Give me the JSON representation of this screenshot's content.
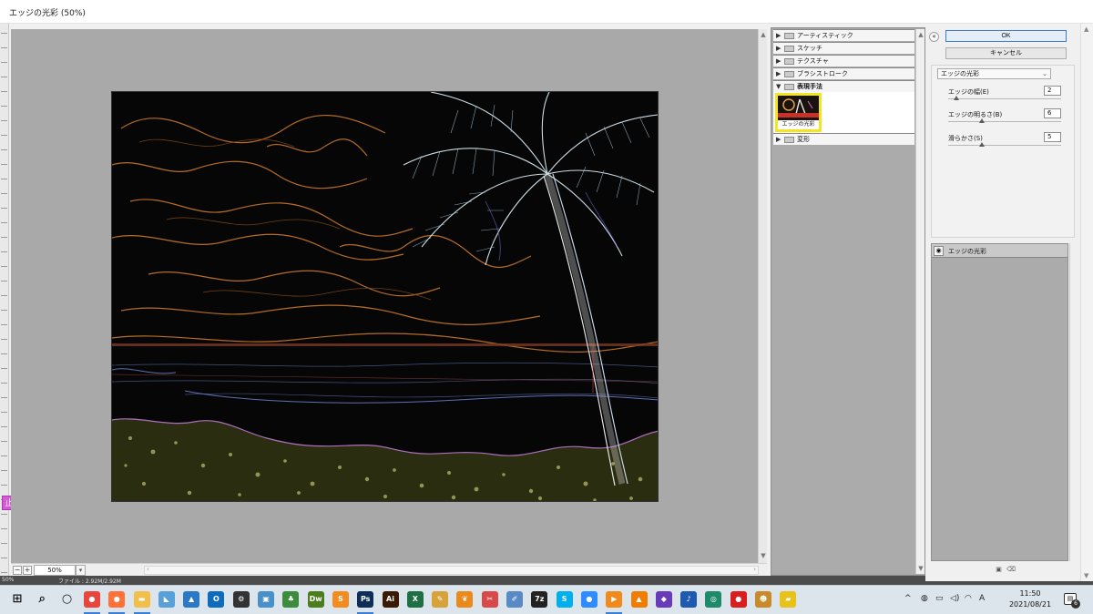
{
  "window": {
    "title": "エッジの光彩 (50%)"
  },
  "ruler": {
    "marker": "止"
  },
  "bottom_bar": {
    "zoom_value": "50%",
    "minus_label": "−",
    "plus_label": "+",
    "dropdown_arrow": "▾",
    "scroll_left": "‹",
    "scroll_right": "›"
  },
  "status_strip": {
    "zoom": "50%",
    "doc_info": "ファイル : 2.92M/2.92M"
  },
  "filter_gallery": {
    "categories": [
      {
        "label": "アーティスティック",
        "expanded": false
      },
      {
        "label": "スケッチ",
        "expanded": false
      },
      {
        "label": "テクスチャ",
        "expanded": false
      },
      {
        "label": "ブラシストローク",
        "expanded": false
      },
      {
        "label": "表現手法",
        "expanded": true
      },
      {
        "label": "変形",
        "expanded": false
      }
    ],
    "selected_thumbnail_label": "エッジの光彩",
    "arrow_collapsed": "▶",
    "arrow_expanded": "▼"
  },
  "dialog": {
    "collapse_icon": "«",
    "ok_label": "OK",
    "cancel_label": "キャンセル",
    "filter_select_value": "エッジの光彩",
    "params": [
      {
        "label": "エッジの幅(E)",
        "value": "2",
        "slider_fraction": 0.07
      },
      {
        "label": "エッジの明るさ(B)",
        "value": "6",
        "slider_fraction": 0.3
      },
      {
        "label": "滑らかさ(S)",
        "value": "5",
        "slider_fraction": 0.3
      }
    ],
    "layer_name": "エッジの光彩",
    "new_layer_icon": "new-layer-icon",
    "delete_layer_icon": "trash-icon"
  },
  "taskbar": {
    "icons": [
      {
        "name": "start-icon",
        "glyph": "⊞",
        "color": "#1a1a1a"
      },
      {
        "name": "search-icon",
        "glyph": "⌕",
        "color": "#1a1a1a"
      },
      {
        "name": "cortana-icon",
        "glyph": "○",
        "color": "#1a1a1a"
      },
      {
        "name": "chrome-icon",
        "glyph": "●",
        "color": "#e8453c"
      },
      {
        "name": "firefox-icon",
        "glyph": "●",
        "color": "#ff7139"
      },
      {
        "name": "file-explorer-icon",
        "glyph": "▬",
        "color": "#f2c04a"
      },
      {
        "name": "app-icon",
        "glyph": "◣",
        "color": "#5aa0d8"
      },
      {
        "name": "photos-icon",
        "glyph": "▲",
        "color": "#2b78c6"
      },
      {
        "name": "outlook-icon",
        "glyph": "O",
        "color": "#0f6cbd"
      },
      {
        "name": "settings-gear-icon",
        "glyph": "⚙",
        "color": "#333333"
      },
      {
        "name": "remote-desktop-icon",
        "glyph": "▣",
        "color": "#4a90c8"
      },
      {
        "name": "green-app-icon",
        "glyph": "♣",
        "color": "#3d8c3d"
      },
      {
        "name": "dreamweaver-icon",
        "glyph": "Dw",
        "color": "#4b7c1d"
      },
      {
        "name": "sublime-text-icon",
        "glyph": "S",
        "color": "#f28c21"
      },
      {
        "name": "photoshop-icon",
        "glyph": "Ps",
        "color": "#0d2e57"
      },
      {
        "name": "illustrator-icon",
        "glyph": "Ai",
        "color": "#3a1a04"
      },
      {
        "name": "excel-icon",
        "glyph": "X",
        "color": "#1d7044"
      },
      {
        "name": "feather-app-icon",
        "glyph": "✎",
        "color": "#d8a23a"
      },
      {
        "name": "butterfly-app-icon",
        "glyph": "❦",
        "color": "#e88a1c"
      },
      {
        "name": "snipping-tool-icon",
        "glyph": "✂",
        "color": "#d84a4a"
      },
      {
        "name": "paint-icon",
        "glyph": "✐",
        "color": "#5a8ac6"
      },
      {
        "name": "7zip-icon",
        "glyph": "7z",
        "color": "#222222"
      },
      {
        "name": "skype-icon",
        "glyph": "S",
        "color": "#00aff0"
      },
      {
        "name": "zoom-icon",
        "glyph": "●",
        "color": "#2d8cff"
      },
      {
        "name": "media-player-icon",
        "glyph": "▶",
        "color": "#f08a1c"
      },
      {
        "name": "vlc-icon",
        "glyph": "▲",
        "color": "#f07c00"
      },
      {
        "name": "purple-app-icon",
        "glyph": "◆",
        "color": "#6a3bb8"
      },
      {
        "name": "music-app-icon",
        "glyph": "♪",
        "color": "#1e5bb0"
      },
      {
        "name": "green-circle-app-icon",
        "glyph": "◎",
        "color": "#1e8a6a"
      },
      {
        "name": "record-icon",
        "glyph": "●",
        "color": "#d81e1e"
      },
      {
        "name": "character-app-icon",
        "glyph": "☻",
        "color": "#c88a2a"
      },
      {
        "name": "sticky-notes-icon",
        "glyph": "▰",
        "color": "#e8c21c"
      }
    ],
    "tray_caret": "^",
    "tray_items": [
      {
        "name": "network-status-icon",
        "glyph": "◍"
      },
      {
        "name": "battery-icon",
        "glyph": "▭"
      },
      {
        "name": "volume-icon",
        "glyph": "◁)"
      },
      {
        "name": "wifi-icon",
        "glyph": "◠"
      },
      {
        "name": "ime-icon",
        "glyph": "A"
      }
    ],
    "clock_time": "11:50",
    "clock_date": "2021/08/21",
    "notification_count": "6"
  },
  "colors": {
    "accent_yellow": "#f5e51c",
    "active_underline": "#3b80d6"
  }
}
